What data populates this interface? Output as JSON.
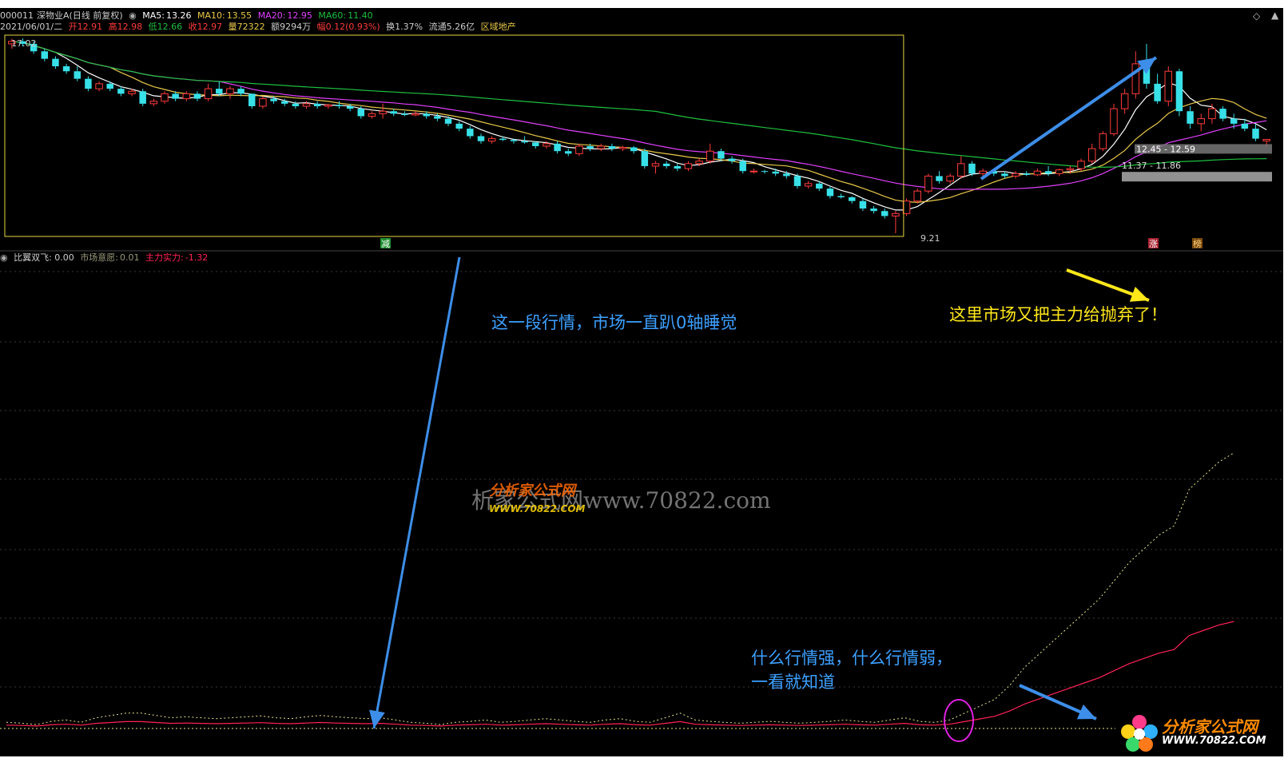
{
  "header": {
    "code": "000011",
    "name": "深物业A",
    "mode": "(日线 前复权)",
    "ma5_label": "MA5:",
    "ma5_value": "13.26",
    "ma10_label": "MA10:",
    "ma10_value": "13.55",
    "ma20_label": "MA20:",
    "ma20_value": "12.95",
    "ma60_label": "MA60:",
    "ma60_value": "11.40",
    "date": "2021/06/01/二",
    "open": "开12.91",
    "high": "高12.98",
    "low": "低12.66",
    "close": "收12.97",
    "volume": "量72322",
    "amount": "额9294万",
    "range": "幅0.12(0.93%)",
    "turnover": "换1.37%",
    "float": "流通5.26亿",
    "sector": "区域地产"
  },
  "indicator": {
    "name": "比翼双飞",
    "value": ": 0.00",
    "m1_label": "市场意愿:",
    "m1_value": "0.01",
    "m2_label": "主力实力:",
    "m2_value": "-1.32"
  },
  "price_labels": {
    "top_price": "17.02",
    "bottom_price": "9.21",
    "band_upper": "12.45 - 12.59",
    "band_lower": "11.37 - 11.86",
    "mark_reduce": "减",
    "mark_rise": "涨",
    "mark_rank": "榜"
  },
  "annotations": {
    "a1": "这一段行情，市场一直趴0轴睡觉",
    "a2": "这里市场又把主力给抛弃了！",
    "a3_line1": "什么行情强，什么行情弱，",
    "a3_line2": "一看就知道"
  },
  "watermark": {
    "text": "析家公式网www.70822.com",
    "logo_text": "分析家公式网",
    "logo_url": "WWW.70822.COM"
  },
  "colors": {
    "background": "#000000",
    "up": "#ff3b3b",
    "down": "#38e0e8",
    "ma5": "#ffffff",
    "ma10": "#e8c84a",
    "ma20": "#e040fb",
    "ma60": "#1fbf3f",
    "indicator_solid": "#ff2255",
    "indicator_dotted": "#e8e48a",
    "box": "#e6d640",
    "arrow_blue": "#3d8ee8",
    "arrow_yellow": "#ffe81a"
  },
  "chart_data": {
    "type": "candlestick",
    "ylim": [
      9.21,
      17.02
    ],
    "ma_periods": [
      5,
      10,
      20,
      60
    ],
    "candles": [
      [
        16.8,
        17.0,
        16.6,
        16.9
      ],
      [
        16.9,
        17.02,
        16.7,
        16.8
      ],
      [
        16.8,
        16.9,
        16.4,
        16.5
      ],
      [
        16.5,
        16.6,
        16.1,
        16.2
      ],
      [
        16.2,
        16.3,
        15.8,
        15.9
      ],
      [
        15.9,
        16.0,
        15.6,
        15.7
      ],
      [
        15.7,
        15.9,
        15.3,
        15.4
      ],
      [
        15.4,
        15.5,
        14.9,
        15.0
      ],
      [
        15.0,
        15.3,
        14.9,
        15.2
      ],
      [
        15.2,
        15.3,
        14.9,
        15.0
      ],
      [
        15.0,
        15.1,
        14.7,
        14.8
      ],
      [
        14.8,
        15.0,
        14.7,
        14.9
      ],
      [
        14.9,
        15.0,
        14.3,
        14.4
      ],
      [
        14.4,
        14.6,
        14.3,
        14.5
      ],
      [
        14.5,
        14.9,
        14.4,
        14.8
      ],
      [
        14.8,
        14.9,
        14.5,
        14.6
      ],
      [
        14.6,
        14.9,
        14.5,
        14.8
      ],
      [
        14.8,
        14.9,
        14.5,
        14.6
      ],
      [
        14.6,
        15.2,
        14.5,
        15.0
      ],
      [
        15.0,
        15.3,
        14.7,
        14.8
      ],
      [
        14.8,
        15.1,
        14.6,
        15.0
      ],
      [
        15.0,
        15.1,
        14.7,
        14.8
      ],
      [
        14.8,
        14.8,
        14.2,
        14.3
      ],
      [
        14.3,
        14.7,
        14.2,
        14.6
      ],
      [
        14.6,
        14.7,
        14.4,
        14.5
      ],
      [
        14.5,
        14.6,
        14.3,
        14.4
      ],
      [
        14.4,
        14.5,
        14.2,
        14.3
      ],
      [
        14.3,
        14.5,
        14.2,
        14.4
      ],
      [
        14.4,
        14.5,
        14.2,
        14.3
      ],
      [
        14.3,
        14.4,
        14.2,
        14.35
      ],
      [
        14.35,
        14.5,
        14.2,
        14.3
      ],
      [
        14.3,
        14.4,
        14.1,
        14.2
      ],
      [
        14.2,
        14.3,
        13.8,
        13.9
      ],
      [
        13.9,
        14.1,
        13.8,
        14.0
      ],
      [
        14.0,
        14.4,
        13.8,
        14.1
      ],
      [
        14.1,
        14.2,
        13.9,
        14.0
      ],
      [
        14.0,
        14.1,
        13.9,
        13.95
      ],
      [
        13.95,
        14.1,
        13.9,
        14.0
      ],
      [
        14.0,
        14.1,
        13.8,
        13.9
      ],
      [
        13.9,
        14.0,
        13.7,
        13.8
      ],
      [
        13.8,
        13.9,
        13.5,
        13.6
      ],
      [
        13.6,
        13.7,
        13.3,
        13.4
      ],
      [
        13.4,
        13.5,
        13.0,
        13.1
      ],
      [
        13.1,
        13.2,
        12.8,
        12.9
      ],
      [
        12.9,
        13.1,
        12.8,
        13.0
      ],
      [
        13.0,
        13.1,
        12.9,
        12.95
      ],
      [
        12.95,
        13.0,
        12.8,
        12.9
      ],
      [
        12.9,
        13.1,
        12.8,
        12.85
      ],
      [
        12.85,
        12.9,
        12.6,
        12.7
      ],
      [
        12.7,
        12.9,
        12.6,
        12.8
      ],
      [
        12.8,
        12.9,
        12.4,
        12.5
      ],
      [
        12.5,
        12.6,
        12.3,
        12.4
      ],
      [
        12.4,
        12.8,
        12.3,
        12.7
      ],
      [
        12.7,
        12.8,
        12.5,
        12.6
      ],
      [
        12.6,
        12.8,
        12.5,
        12.7
      ],
      [
        12.7,
        12.8,
        12.5,
        12.6
      ],
      [
        12.6,
        12.7,
        12.5,
        12.65
      ],
      [
        12.65,
        12.7,
        12.4,
        12.5
      ],
      [
        12.5,
        12.6,
        11.8,
        11.9
      ],
      [
        11.9,
        12.1,
        11.6,
        12.0
      ],
      [
        12.0,
        12.1,
        11.8,
        11.9
      ],
      [
        11.9,
        12.0,
        11.7,
        11.8
      ],
      [
        11.8,
        12.1,
        11.7,
        12.0
      ],
      [
        12.0,
        12.2,
        11.9,
        12.1
      ],
      [
        12.1,
        12.8,
        12.0,
        12.5
      ],
      [
        12.5,
        12.6,
        12.1,
        12.2
      ],
      [
        12.2,
        12.3,
        12.0,
        12.1
      ],
      [
        12.1,
        12.2,
        11.6,
        11.7
      ],
      [
        11.7,
        11.8,
        11.6,
        11.7
      ],
      [
        11.7,
        11.75,
        11.6,
        11.68
      ],
      [
        11.68,
        11.8,
        11.5,
        11.6
      ],
      [
        11.6,
        11.7,
        11.4,
        11.5
      ],
      [
        11.5,
        11.6,
        11.0,
        11.1
      ],
      [
        11.1,
        11.3,
        11.0,
        11.2
      ],
      [
        11.2,
        11.3,
        10.9,
        11.0
      ],
      [
        11.0,
        11.1,
        10.6,
        10.7
      ],
      [
        10.7,
        10.8,
        10.6,
        10.65
      ],
      [
        10.65,
        10.7,
        10.4,
        10.5
      ],
      [
        10.5,
        10.6,
        10.1,
        10.2
      ],
      [
        10.2,
        10.3,
        10.0,
        10.1
      ],
      [
        10.1,
        10.2,
        9.8,
        9.9
      ],
      [
        9.9,
        10.1,
        9.21,
        10.0
      ],
      [
        10.0,
        10.6,
        9.9,
        10.5
      ],
      [
        10.5,
        11.0,
        10.4,
        10.9
      ],
      [
        10.9,
        11.6,
        10.8,
        11.5
      ],
      [
        11.5,
        11.7,
        11.2,
        11.3
      ],
      [
        11.3,
        11.6,
        11.2,
        11.5
      ],
      [
        11.5,
        12.3,
        11.4,
        12.0
      ],
      [
        12.0,
        12.1,
        11.5,
        11.6
      ],
      [
        11.6,
        11.8,
        11.4,
        11.7
      ],
      [
        11.7,
        11.8,
        11.5,
        11.6
      ],
      [
        11.6,
        11.7,
        11.4,
        11.5
      ],
      [
        11.5,
        11.7,
        11.4,
        11.6
      ],
      [
        11.6,
        11.7,
        11.5,
        11.55
      ],
      [
        11.55,
        11.8,
        11.5,
        11.7
      ],
      [
        11.7,
        11.9,
        11.5,
        11.6
      ],
      [
        11.6,
        11.8,
        11.5,
        11.75
      ],
      [
        11.75,
        11.9,
        11.6,
        11.8
      ],
      [
        11.8,
        12.2,
        11.7,
        12.1
      ],
      [
        12.1,
        12.8,
        12.0,
        12.6
      ],
      [
        12.6,
        13.3,
        12.5,
        13.2
      ],
      [
        13.2,
        14.4,
        13.1,
        14.2
      ],
      [
        14.2,
        15.0,
        14.0,
        14.8
      ],
      [
        14.8,
        16.5,
        14.6,
        16.0
      ],
      [
        16.0,
        16.8,
        15.0,
        15.2
      ],
      [
        15.2,
        15.6,
        14.4,
        14.5
      ],
      [
        14.5,
        15.9,
        14.3,
        15.7
      ],
      [
        15.7,
        15.8,
        13.9,
        14.1
      ],
      [
        14.1,
        14.3,
        13.4,
        13.6
      ],
      [
        13.6,
        14.0,
        13.3,
        13.8
      ],
      [
        13.8,
        14.4,
        13.6,
        14.2
      ],
      [
        14.2,
        14.3,
        13.7,
        13.8
      ],
      [
        13.8,
        14.0,
        13.4,
        13.6
      ],
      [
        13.6,
        13.8,
        13.3,
        13.4
      ],
      [
        13.4,
        13.6,
        12.9,
        13.0
      ],
      [
        12.91,
        12.98,
        12.66,
        12.97
      ]
    ],
    "indicator_solid": [
      0.1,
      0.08,
      0.05,
      0.12,
      0.15,
      0.1,
      0.2,
      0.25,
      0.3,
      0.3,
      0.25,
      0.2,
      0.22,
      0.2,
      0.18,
      0.2,
      0.22,
      0.24,
      0.2,
      0.18,
      0.22,
      0.25,
      0.22,
      0.2,
      0.18,
      0.2,
      0.15,
      0.1,
      0.08,
      0.05,
      0.1,
      0.12,
      0.15,
      0.1,
      0.12,
      0.15,
      0.18,
      0.15,
      0.12,
      0.1,
      0.15,
      0.18,
      0.12,
      0.1,
      0.2,
      0.3,
      0.15,
      0.12,
      0.1,
      0.08,
      0.1,
      0.12,
      0.1,
      0.08,
      0.1,
      0.12,
      0.15,
      0.12,
      0.1,
      0.15,
      0.2,
      0.12,
      0.1,
      0.15,
      0.3,
      0.45,
      0.6,
      0.9,
      1.3,
      1.6,
      1.9,
      2.2,
      2.5,
      2.8,
      3.2,
      3.6,
      3.9,
      4.2,
      4.4,
      5.2,
      5.5,
      5.8,
      6.0
    ],
    "indicator_dotted_note": "auxiliary series",
    "boxes": [
      {
        "x0": 0,
        "x1": 81,
        "y_top": 17.02,
        "y_bottom": 9.21
      }
    ]
  }
}
